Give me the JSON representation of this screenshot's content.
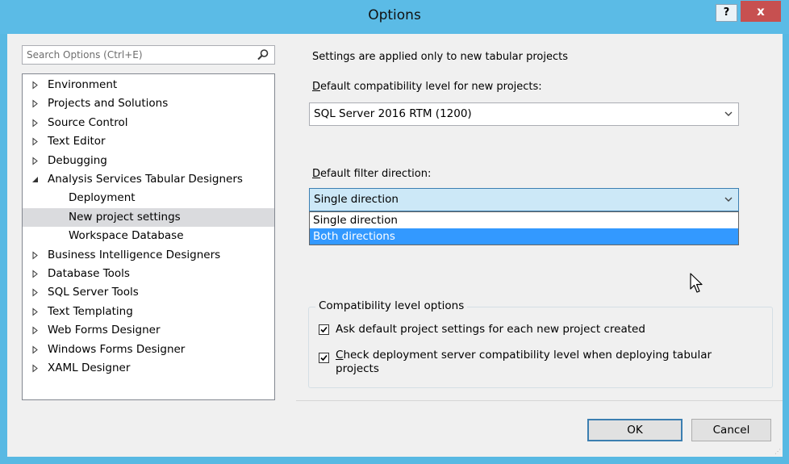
{
  "window": {
    "title": "Options",
    "help_label": "?",
    "close_label": "x"
  },
  "search": {
    "placeholder": "Search Options (Ctrl+E)",
    "icon": "search-icon"
  },
  "tree": [
    {
      "label": "Environment",
      "expanded": false,
      "level": 0
    },
    {
      "label": "Projects and Solutions",
      "expanded": false,
      "level": 0
    },
    {
      "label": "Source Control",
      "expanded": false,
      "level": 0
    },
    {
      "label": "Text Editor",
      "expanded": false,
      "level": 0
    },
    {
      "label": "Debugging",
      "expanded": false,
      "level": 0
    },
    {
      "label": "Analysis Services Tabular Designers",
      "expanded": true,
      "level": 0
    },
    {
      "label": "Deployment",
      "level": 1
    },
    {
      "label": "New project settings",
      "level": 1,
      "selected": true
    },
    {
      "label": "Workspace Database",
      "level": 1
    },
    {
      "label": "Business Intelligence Designers",
      "expanded": false,
      "level": 0
    },
    {
      "label": "Database Tools",
      "expanded": false,
      "level": 0
    },
    {
      "label": "SQL Server Tools",
      "expanded": false,
      "level": 0
    },
    {
      "label": "Text Templating",
      "expanded": false,
      "level": 0
    },
    {
      "label": "Web Forms Designer",
      "expanded": false,
      "level": 0
    },
    {
      "label": "Windows Forms Designer",
      "expanded": false,
      "level": 0
    },
    {
      "label": "XAML Designer",
      "expanded": false,
      "level": 0
    }
  ],
  "settings": {
    "intro": "Settings are applied only to new tabular projects",
    "compat_label_accel": "D",
    "compat_label_rest": "efault compatibility level for new projects:",
    "compat_value": "SQL Server 2016 RTM (1200)",
    "filter_label_accel": "D",
    "filter_label_rest": "efault filter direction:",
    "filter_value": "Single direction",
    "filter_options": [
      "Single direction",
      "Both directions"
    ],
    "filter_highlighted": "Both directions"
  },
  "compat_options": {
    "group_title": "Compatibility level options",
    "ask_label": "Ask default project settings for each new project created",
    "ask_checked": true,
    "check_accel": "C",
    "check_label_rest": "heck deployment server compatibility level when deploying tabular",
    "check_label_line2": "projects",
    "check_checked": true
  },
  "buttons": {
    "ok": "OK",
    "cancel": "Cancel"
  },
  "colors": {
    "titlebar": "#5bbbe6",
    "close": "#c75050",
    "highlight": "#3399ff",
    "selected_tree": "#dadbde"
  }
}
